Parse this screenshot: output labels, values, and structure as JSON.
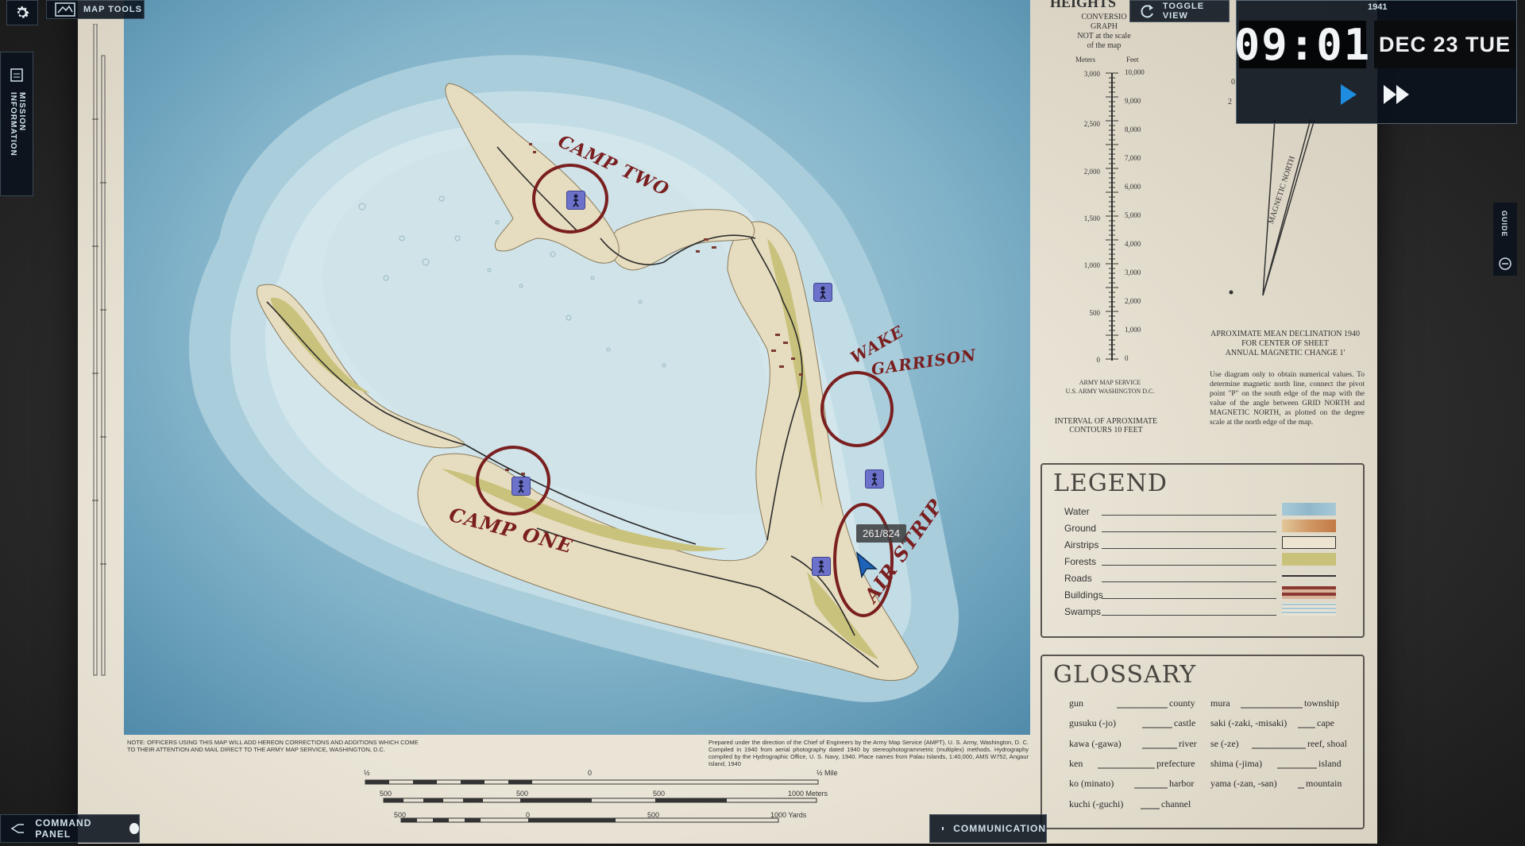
{
  "hud": {
    "map_tools_label": "MAP TOOLS",
    "mission_label": "MISSION INFORMATION",
    "toggle_view_label": "TOGGLE VIEW",
    "guide_label": "GUIDE",
    "command_panel_label": "COMMAND PANEL",
    "communication_label": "COMMUNICATION"
  },
  "time": {
    "year": "1941",
    "clock": "09:01",
    "date": "DEC 23 TUE"
  },
  "map": {
    "labels": {
      "camp_two": "CAMP TWO",
      "wake": "WAKE",
      "garrison": "GARRISON",
      "camp_one": "CAMP ONE",
      "air_strip": "AIR STRIP"
    },
    "cursor_tooltip": "261/824",
    "note_left": "NOTE: OFFICERS USING THIS MAP WILL ADD HEREON CORRECTIONS AND ADDITIONS WHICH COME TO THEIR ATTENTION AND MAIL DIRECT TO THE ARMY MAP SERVICE, WASHINGTON, D.C.",
    "note_right": "Prepared under the direction of the Chief of Engineers by the Army Map Service (AMPT), U. S. Army, Washington, D. C. Compiled in 1940 from aerial photography dated 1940 by stereophotogrammetric (multiplex) methods. Hydrography compiled by the Hydrographic Office, U. S. Navy, 1940. Place names from Palau Islands, 1:40,000, AMS W752, Angaur Island, 1940",
    "scale": {
      "half": "½",
      "zero": "0",
      "half_mile": "½ Mile",
      "m500a": "500",
      "m500b": "500",
      "m500c": "500",
      "meters": "1000 Meters",
      "y500a": "500",
      "y0": "0",
      "y500b": "500",
      "yards": "1000 Yards"
    }
  },
  "heights": {
    "title": "HEIGHTS",
    "conv": [
      "CONVERSIO",
      "GRAPH",
      "NOT at the scale",
      "of the map"
    ],
    "meters_label": "Meters",
    "feet_label": "Feet",
    "meters_ticks": [
      "3,000",
      "2,500",
      "2,000",
      "1,500",
      "1,000",
      "500",
      "0"
    ],
    "feet_ticks": [
      "10,000",
      "9,000",
      "8,000",
      "7,000",
      "6,000",
      "5,000",
      "4,000",
      "3,000",
      "2,000",
      "1,000",
      "0"
    ],
    "ams1": "ARMY MAP SERVICE",
    "ams2": "U.S. ARMY WASHINGTON D.C.",
    "interval1": "INTERVAL OF APROXIMATE",
    "interval2": "CONTOURS 10 FEET"
  },
  "declination": {
    "magnetic_north": "MAGNETIC NORTH",
    "head1": "APROXIMATE MEAN DECLINATION 1940",
    "head2": "FOR CENTER OF SHEET",
    "head3": "ANNUAL MAGNETIC CHANGE 1'",
    "body": "Use diagram only to obtain numerical values. To determine magnetic north line, connect the pivot point \"P\" on the south edge of the map with the value of the angle between GRID NORTH and MAGNETIC NORTH, as plotted on the degree scale at the north edge of the map.",
    "tick_0": "0",
    "tick_2": "2"
  },
  "legend": {
    "title": "LEGEND",
    "items": [
      {
        "label": "Water",
        "color": "#9fc3d3"
      },
      {
        "label": "Ground",
        "color": "#d4a577"
      },
      {
        "label": "Airstrips",
        "color": "#ece4d0"
      },
      {
        "label": "Forests",
        "color": "#c8c27a"
      },
      {
        "label": "Roads",
        "color": "#333333"
      },
      {
        "label": "Buildings",
        "color": "#8a3a33"
      },
      {
        "label": "Swamps",
        "color": "#bcd4dc"
      }
    ]
  },
  "glossary": {
    "title": "GLOSSARY",
    "left": [
      {
        "term": "gun",
        "meaning": "county"
      },
      {
        "term": "gusuku (-jo)",
        "meaning": "castle"
      },
      {
        "term": "kawa (-gawa)",
        "meaning": "river"
      },
      {
        "term": "ken",
        "meaning": "prefecture"
      },
      {
        "term": "ko (minato)",
        "meaning": "harbor"
      },
      {
        "term": "kuchi (-guchi)",
        "meaning": "channel"
      }
    ],
    "right": [
      {
        "term": "mura",
        "meaning": "township"
      },
      {
        "term": "saki (-zaki, -misaki)",
        "meaning": "cape"
      },
      {
        "term": "se (-ze)",
        "meaning": "reef, shoal"
      },
      {
        "term": "shima (-jima)",
        "meaning": "island"
      },
      {
        "term": "yama (-zan, -san)",
        "meaning": "mountain"
      }
    ]
  }
}
